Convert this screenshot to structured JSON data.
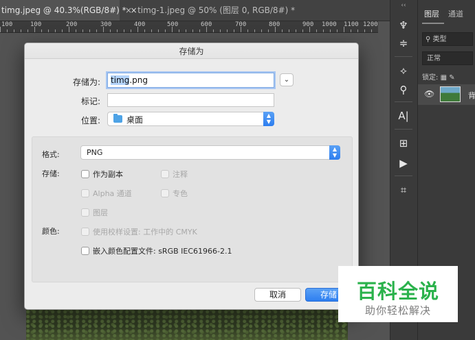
{
  "tabs": [
    {
      "label": "timg.jpeg @ 40.3%(RGB/8#) *",
      "close": "×"
    },
    {
      "label": "timg-1.jpeg @ 50% (图层 0, RGB/8#) *",
      "close": "×"
    }
  ],
  "ruler": [
    "100",
    "100",
    "200",
    "300",
    "400",
    "500",
    "600",
    "700",
    "800",
    "900",
    "1000",
    "1100",
    "1200"
  ],
  "toolbar": {
    "collapse": "‹‹",
    "tools": [
      "puppet-warp-icon",
      "properties-icon",
      "tool-presets-icon",
      "stamp-icon",
      "character-icon",
      "paragraph-icon",
      "play-icon",
      "crop-icon"
    ],
    "glyphs": [
      "♆",
      "≑",
      "⟡",
      "⚲",
      "A|",
      "⊞",
      "▶",
      "⌗"
    ]
  },
  "layers_panel": {
    "tab_layers": "图层",
    "tab_channels": "通道",
    "kind_placeholder": "类型",
    "blend_mode": "正常",
    "lock_label": "锁定:",
    "layer_name": "背"
  },
  "dialog": {
    "title": "存储为",
    "save_as_label": "存储为:",
    "filename_selected": "timg",
    "filename_rest": ".png",
    "expand": "⌄",
    "tags_label": "标记:",
    "where_label": "位置:",
    "where_value": "桌面",
    "format_label": "格式:",
    "format_value": "PNG",
    "save_group_label": "存储:",
    "color_label": "颜色:",
    "options": {
      "as_copy": "作为副本",
      "notes": "注释",
      "alpha": "Alpha 通道",
      "spot": "专色",
      "layers": "图层",
      "proof": "使用校样设置: 工作中的 CMYK",
      "embed": "嵌入颜色配置文件: sRGB IEC61966-2.1"
    },
    "cancel": "取消",
    "save": "存储"
  },
  "watermark": {
    "title": "百科全说",
    "subtitle": "助你轻松解决"
  },
  "colors": {
    "accent": "#2d7ef0",
    "watermark_green": "#2bb24c",
    "ps_background": "#535353"
  }
}
